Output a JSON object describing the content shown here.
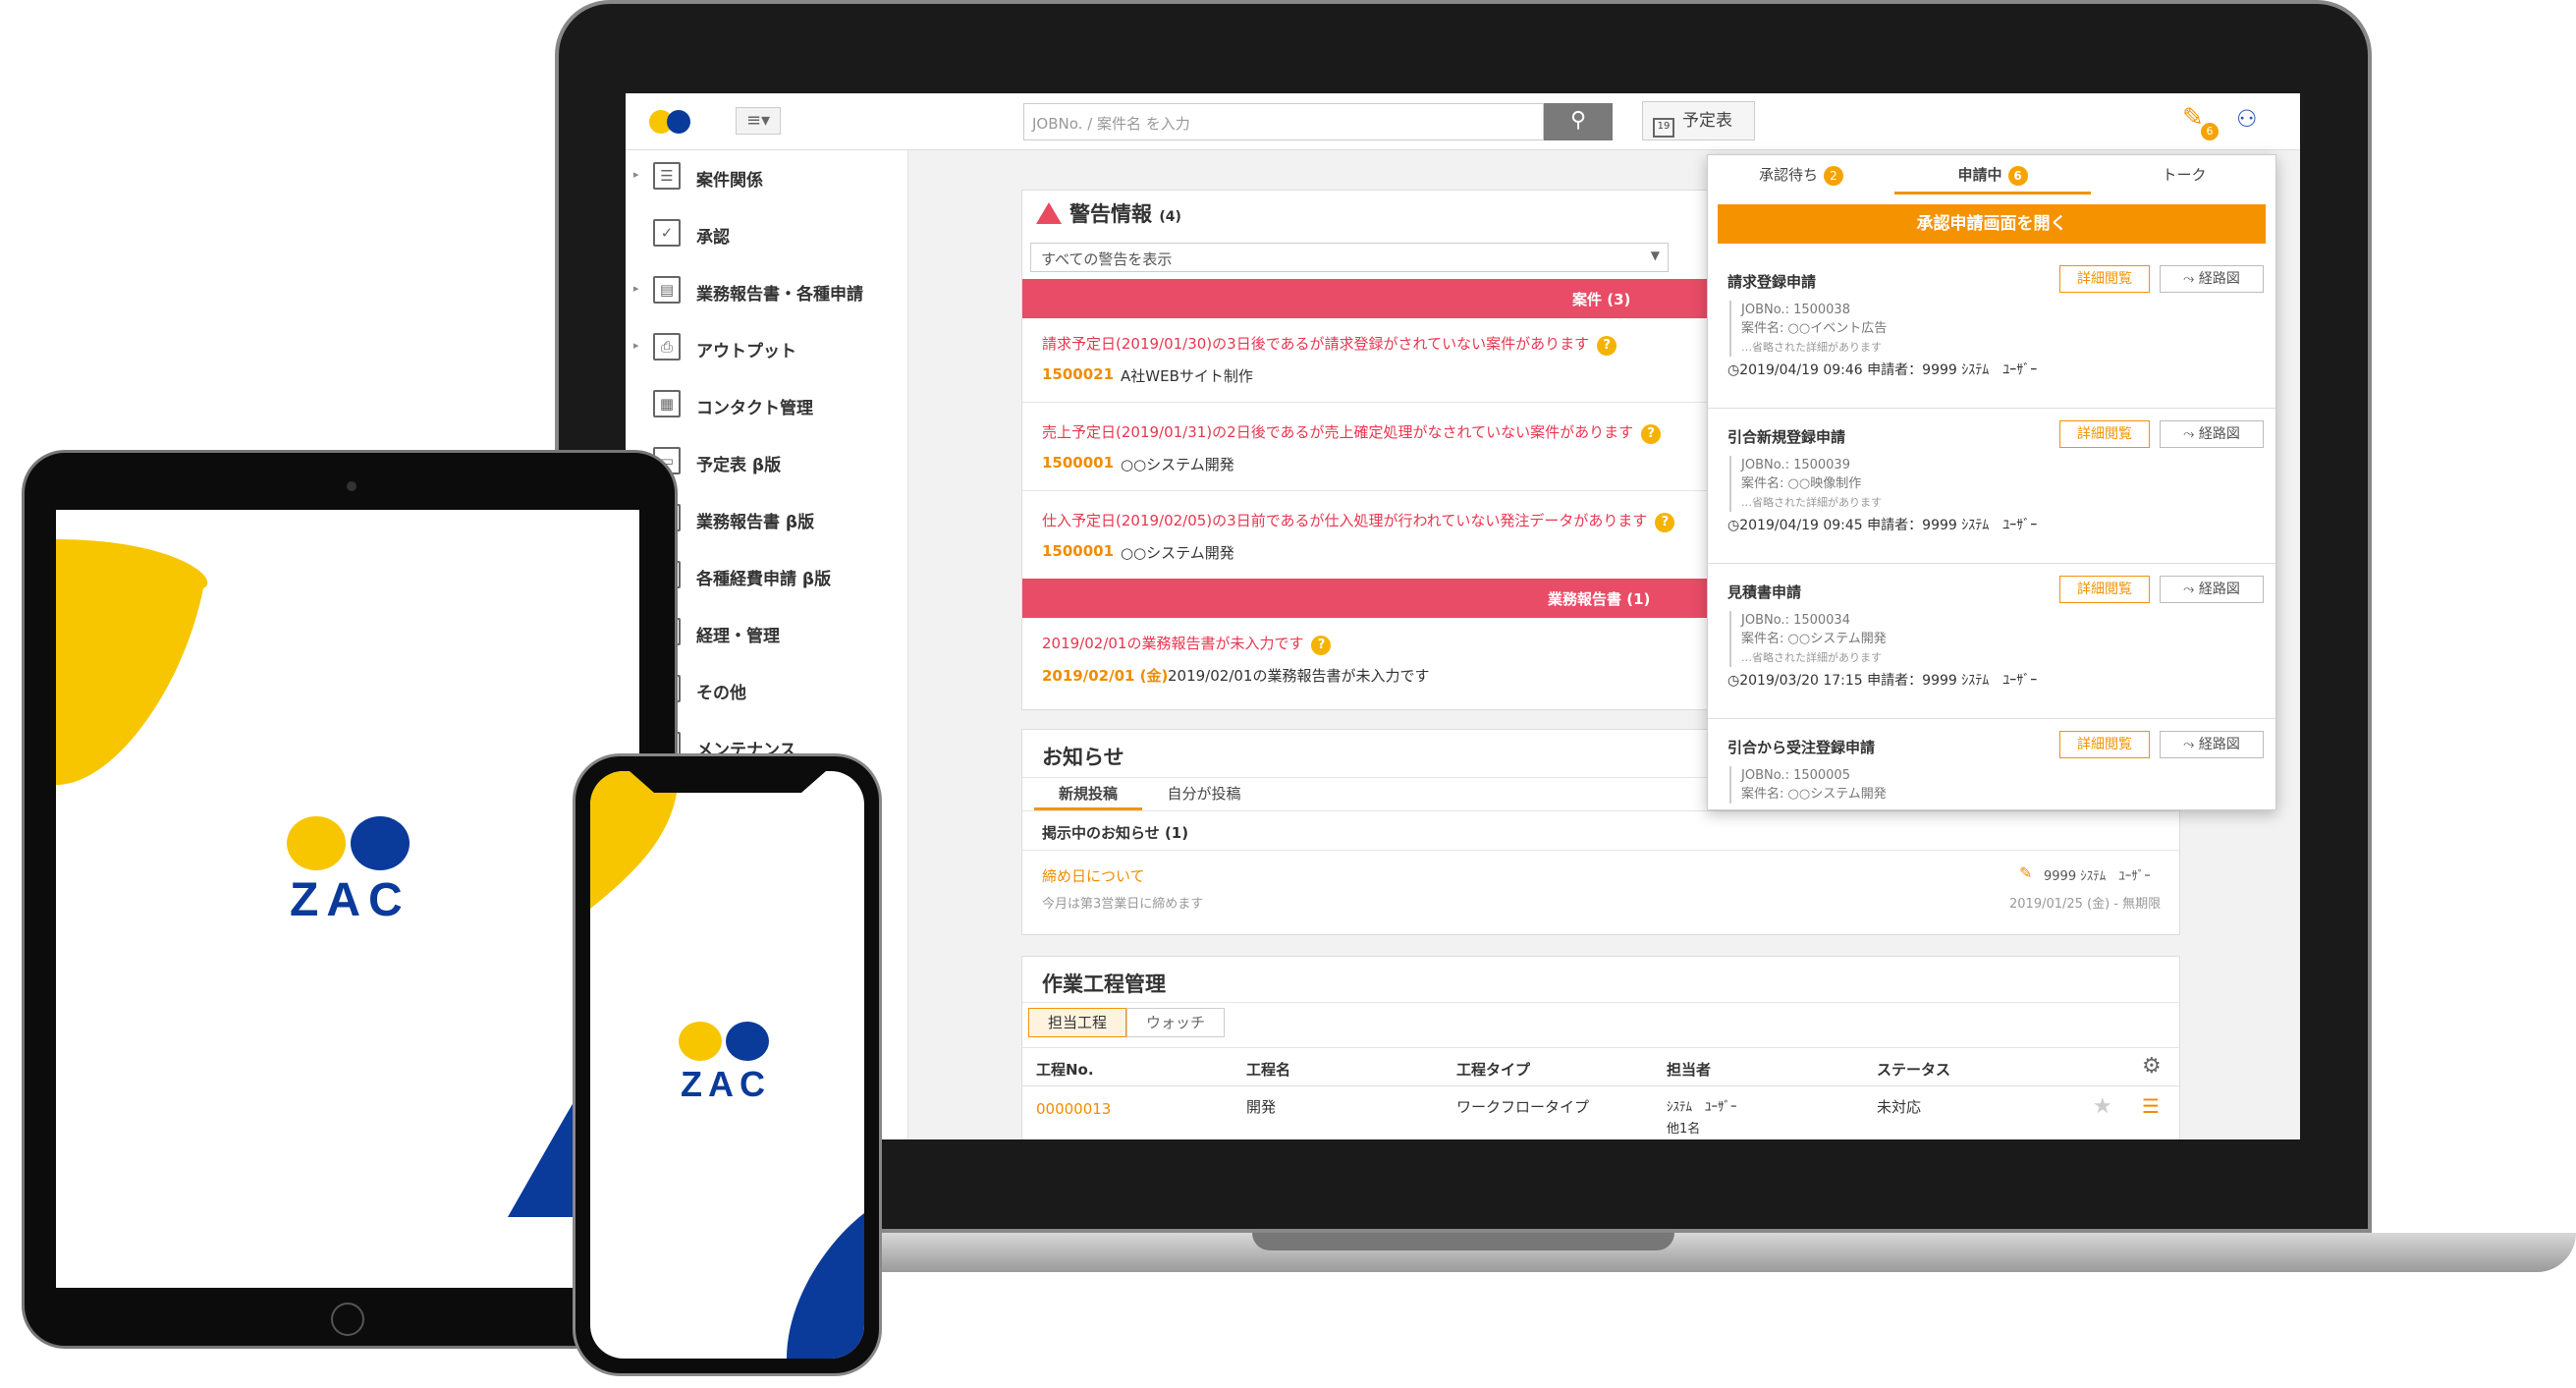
{
  "brand": {
    "yellow": "#f7c600",
    "blue": "#0a3a9a",
    "orange": "#f59200",
    "pink": "#e94c66"
  },
  "topbar": {
    "search_placeholder": "JOBNo. / 案件名 を入力",
    "schedule_label": "予定表",
    "schedule_day": "19",
    "pin_badge": "6"
  },
  "sidebar": {
    "items": [
      {
        "label": "案件関係",
        "icon": "list-icon",
        "expandable": true
      },
      {
        "label": "承認",
        "icon": "check-icon",
        "expandable": false
      },
      {
        "label": "業務報告書・各種申請",
        "icon": "report-icon",
        "expandable": true
      },
      {
        "label": "アウトプット",
        "icon": "printer-icon",
        "expandable": true
      },
      {
        "label": "コンタクト管理",
        "icon": "contact-icon",
        "expandable": false
      },
      {
        "label": "予定表 β版",
        "icon": "calendar-icon",
        "expandable": false
      },
      {
        "label": "業務報告書 β版",
        "icon": "document-icon",
        "expandable": false
      },
      {
        "label": "各種経費申請 β版",
        "icon": "expense-icon",
        "expandable": false
      },
      {
        "label": "経理・管理",
        "icon": "accounting-icon",
        "expandable": false
      },
      {
        "label": "その他",
        "icon": "other-icon",
        "expandable": false
      },
      {
        "label": "メンテナンス",
        "icon": "maintenance-icon",
        "expandable": false
      }
    ]
  },
  "warnings": {
    "title": "警告情報",
    "count": "(4)",
    "filter": "すべての警告を表示",
    "project_header": "案件",
    "project_count": "(3)",
    "items": [
      {
        "text": "請求予定日(2019/01/30)の3日後であるが請求登録がされていない案件があります",
        "job": "1500021",
        "name": "A社WEBサイト制作"
      },
      {
        "text": "売上予定日(2019/01/31)の2日後であるが売上確定処理がなされていない案件があります",
        "job": "1500001",
        "name": "○○システム開発"
      },
      {
        "text": "仕入予定日(2019/02/05)の3日前であるが仕入処理が行われていない発注データがあります",
        "job": "1500001",
        "name": "○○システム開発"
      }
    ],
    "report_header": "業務報告書",
    "report_count": "(1)",
    "report_item": {
      "text": "2019/02/01の業務報告書が未入力です",
      "date": "2019/02/01 (金)",
      "desc": "2019/02/01の業務報告書が未入力です"
    }
  },
  "notice": {
    "title": "お知らせ",
    "tabs": [
      "新規投稿",
      "自分が投稿"
    ],
    "section": "掲示中のお知らせ",
    "section_count": "(1)",
    "item_title": "締め日について",
    "item_desc": "今月は第3営業日に締めます",
    "author": "9999 ｼｽﾃﾑ　ﾕｰｻﾞｰ",
    "period": "2019/01/25 (金) - 無期限"
  },
  "process": {
    "title": "作業工程管理",
    "tabs": [
      "担当工程",
      "ウォッチ"
    ],
    "columns": [
      "工程No.",
      "工程名",
      "工程タイプ",
      "担当者",
      "ステータス"
    ],
    "row": {
      "no": "00000013",
      "name": "開発",
      "type": "ワークフロータイプ",
      "person": "ｼｽﾃﾑ　ﾕｰｻﾞｰ",
      "person_more": "他1名",
      "status": "未対応"
    }
  },
  "popup": {
    "tabs": [
      {
        "label": "承認待ち",
        "badge": "2"
      },
      {
        "label": "申請中",
        "badge": "6"
      },
      {
        "label": "トーク",
        "badge": ""
      }
    ],
    "open_button": "承認申請画面を開く",
    "detail_label": "詳細閲覧",
    "route_label": "経路図",
    "omitted": "…省略された詳細があります",
    "requests": [
      {
        "title": "請求登録申請",
        "job": "JOBNo.: 1500038",
        "case": "案件名: ○○イベント広告",
        "foot": "2019/04/19 09:46  申請者：9999 ｼｽﾃﾑ　ﾕｰｻﾞｰ"
      },
      {
        "title": "引合新規登録申請",
        "job": "JOBNo.: 1500039",
        "case": "案件名: ○○映像制作",
        "foot": "2019/04/19 09:45  申請者：9999 ｼｽﾃﾑ　ﾕｰｻﾞｰ"
      },
      {
        "title": "見積書申請",
        "job": "JOBNo.: 1500034",
        "case": "案件名: ○○システム開発",
        "foot": "2019/03/20 17:15  申請者：9999 ｼｽﾃﾑ　ﾕｰｻﾞｰ"
      },
      {
        "title": "引合から受注登録申請",
        "job": "JOBNo.: 1500005",
        "case": "案件名: ○○システム開発",
        "foot": ""
      }
    ]
  },
  "logo": {
    "text": "ZAC"
  }
}
